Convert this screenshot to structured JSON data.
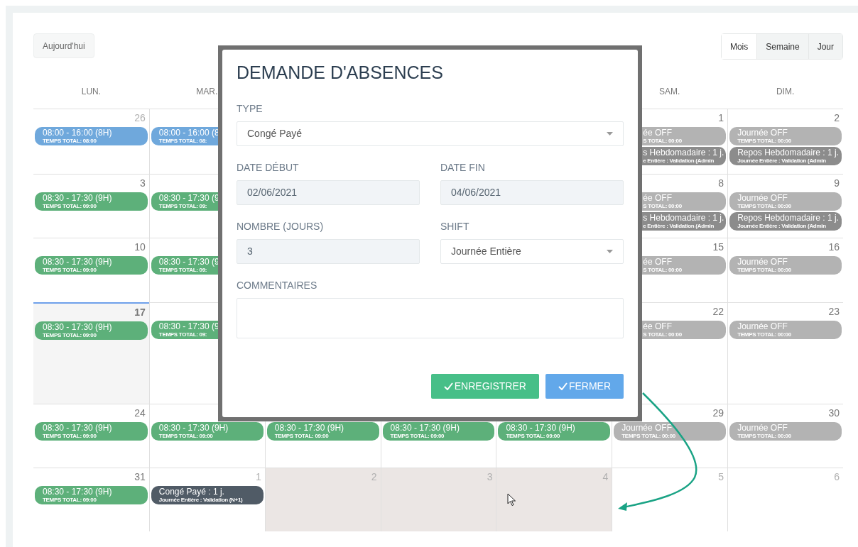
{
  "toolbar": {
    "today_button": "Aujourd'hui",
    "views": [
      {
        "label": "Mois",
        "selected": true
      },
      {
        "label": "Semaine",
        "selected": false
      },
      {
        "label": "Jour",
        "selected": false
      }
    ]
  },
  "weekdays": [
    "LUN.",
    "MAR.",
    "SAM.",
    "DIM."
  ],
  "weeks": [
    {
      "cells": [
        {
          "day": "26",
          "other_month": true,
          "today": false,
          "selected": false,
          "events": [
            {
              "title": "08:00 - 16:00 (8H)",
              "subtitle": "TEMPS TOTAL: 08:00",
              "color": "#6fa8dc"
            }
          ]
        },
        {
          "today": false,
          "selected": false,
          "events": [
            {
              "title": "08:00 - 16:00 (8",
              "subtitle": "TEMPS TOTAL: 08:",
              "color": "#6fa8dc"
            }
          ]
        },
        null,
        null,
        null,
        {
          "day": "1",
          "other_month": false,
          "today": false,
          "selected": false,
          "events": [
            {
              "title": "ée OFF",
              "subtitle": "S TOTAL: 00:00",
              "color": "#b3b3b3"
            },
            {
              "title": "s Hebdomadaire : 1 j.",
              "subtitle": "e Entière : Validation (Admin",
              "color": "#8c8c8c"
            }
          ]
        },
        {
          "day": "2",
          "other_month": false,
          "today": false,
          "selected": false,
          "events": [
            {
              "title": "Journée OFF",
              "subtitle": "TEMPS TOTAL: 00:00",
              "color": "#b3b3b3"
            },
            {
              "title": "Repos Hebdomadaire : 1 j.",
              "subtitle": "Journée Entière : Validation (Admin",
              "color": "#8c8c8c"
            }
          ]
        }
      ]
    },
    {
      "cells": [
        {
          "day": "3",
          "other_month": false,
          "today": false,
          "selected": false,
          "events": [
            {
              "title": "08:30 - 17:30 (9H)",
              "subtitle": "TEMPS TOTAL: 09:00",
              "color": "#5db07a"
            }
          ]
        },
        {
          "today": false,
          "selected": false,
          "events": [
            {
              "title": "08:30 - 17:30 (9",
              "subtitle": "TEMPS TOTAL: 09:",
              "color": "#5db07a"
            }
          ]
        },
        null,
        null,
        null,
        {
          "day": "8",
          "other_month": false,
          "today": false,
          "selected": false,
          "events": [
            {
              "title": "ée OFF",
              "subtitle": "S TOTAL: 00:00",
              "color": "#b3b3b3"
            },
            {
              "title": "s Hebdomadaire : 1 j.",
              "subtitle": "e Entière : Validation (Admin",
              "color": "#8c8c8c"
            }
          ]
        },
        {
          "day": "9",
          "other_month": false,
          "today": false,
          "selected": false,
          "events": [
            {
              "title": "Journée OFF",
              "subtitle": "TEMPS TOTAL: 00:00",
              "color": "#b3b3b3"
            },
            {
              "title": "Repos Hebdomadaire : 1 j.",
              "subtitle": "Journée Entière : Validation (Admin",
              "color": "#8c8c8c"
            }
          ]
        }
      ]
    },
    {
      "cells": [
        {
          "day": "10",
          "other_month": false,
          "today": false,
          "selected": false,
          "events": [
            {
              "title": "08:30 - 17:30 (9H)",
              "subtitle": "TEMPS TOTAL: 09:00",
              "color": "#5db07a"
            }
          ]
        },
        {
          "today": false,
          "selected": false,
          "events": [
            {
              "title": "08:30 - 17:30 (9",
              "subtitle": "TEMPS TOTAL: 09:",
              "color": "#5db07a"
            }
          ]
        },
        null,
        null,
        null,
        {
          "day": "15",
          "other_month": false,
          "today": false,
          "selected": false,
          "events": [
            {
              "title": "ée OFF",
              "subtitle": "S TOTAL: 00:00",
              "color": "#b3b3b3"
            }
          ]
        },
        {
          "day": "16",
          "other_month": false,
          "today": false,
          "selected": false,
          "events": [
            {
              "title": "Journée OFF",
              "subtitle": "TEMPS TOTAL: 00:00",
              "color": "#b3b3b3"
            }
          ]
        }
      ]
    },
    {
      "cells": [
        {
          "day": "17",
          "other_month": false,
          "today": true,
          "selected": false,
          "events": [
            {
              "title": "08:30 - 17:30 (9H)",
              "subtitle": "TEMPS TOTAL: 09:00",
              "color": "#5db07a"
            }
          ]
        },
        {
          "today": false,
          "selected": false,
          "events": [
            {
              "title": "08:30 - 17:30 (9",
              "subtitle": "TEMPS TOTAL: 09:",
              "color": "#5db07a"
            }
          ]
        },
        null,
        null,
        null,
        {
          "day": "22",
          "other_month": false,
          "today": false,
          "selected": false,
          "events": [
            {
              "title": "ée OFF",
              "subtitle": "S TOTAL: 00:00",
              "color": "#b3b3b3"
            }
          ]
        },
        {
          "day": "23",
          "other_month": false,
          "today": false,
          "selected": false,
          "events": [
            {
              "title": "Journée OFF",
              "subtitle": "TEMPS TOTAL: 00:00",
              "color": "#b3b3b3"
            }
          ]
        }
      ]
    },
    {
      "cells": [
        {
          "day": "24",
          "other_month": false,
          "today": false,
          "selected": false,
          "events": [
            {
              "title": "08:30 - 17:30 (9H)",
              "subtitle": "TEMPS TOTAL: 09:00",
              "color": "#5db07a"
            }
          ]
        },
        {
          "today": false,
          "selected": false,
          "events": [
            {
              "title": "08:30 - 17:30 (9H)",
              "subtitle": "TEMPS TOTAL: 09:00",
              "color": "#5db07a"
            }
          ]
        },
        {
          "today": false,
          "selected": false,
          "events": [
            {
              "title": "08:30 - 17:30 (9H)",
              "subtitle": "TEMPS TOTAL: 09:00",
              "color": "#5db07a"
            }
          ]
        },
        {
          "today": false,
          "selected": false,
          "events": [
            {
              "title": "08:30 - 17:30 (9H)",
              "subtitle": "TEMPS TOTAL: 09:00",
              "color": "#5db07a"
            }
          ]
        },
        {
          "today": false,
          "selected": false,
          "events": [
            {
              "title": "08:30 - 17:30 (9H)",
              "subtitle": "TEMPS TOTAL: 09:00",
              "color": "#5db07a"
            }
          ]
        },
        {
          "day": "29",
          "other_month": false,
          "today": false,
          "selected": false,
          "events": [
            {
              "title": "Journée OFF",
              "subtitle": "TEMPS TOTAL: 00:00",
              "color": "#b3b3b3"
            }
          ]
        },
        {
          "day": "30",
          "other_month": false,
          "today": false,
          "selected": false,
          "events": [
            {
              "title": "Journée OFF",
              "subtitle": "TEMPS TOTAL: 00:00",
              "color": "#b3b3b3"
            }
          ]
        }
      ]
    },
    {
      "cells": [
        {
          "day": "31",
          "other_month": false,
          "today": false,
          "selected": false,
          "events": [
            {
              "title": "08:30 - 17:30 (9H)",
              "subtitle": "TEMPS TOTAL: 09:00",
              "color": "#5db07a"
            }
          ]
        },
        {
          "day": "1",
          "other_month": true,
          "today": false,
          "selected": false,
          "events": [
            {
              "title": "Congé Payé : 1 j.",
              "subtitle": "Journée Entière : Validation (N+1)",
              "color": "#505b66"
            }
          ]
        },
        {
          "day": "2",
          "other_month": true,
          "today": false,
          "selected": true
        },
        {
          "day": "3",
          "other_month": true,
          "today": false,
          "selected": true
        },
        {
          "day": "4",
          "other_month": true,
          "today": false,
          "selected": true
        },
        {
          "day": "5",
          "other_month": true,
          "today": false,
          "selected": false
        },
        {
          "day": "6",
          "other_month": true,
          "today": false,
          "selected": false
        }
      ]
    }
  ],
  "modal": {
    "title": "DEMANDE D'ABSENCES",
    "fields": [
      {
        "label": "TYPE",
        "kind": "select",
        "value": "Congé Payé",
        "disabled": false,
        "wide": true
      },
      {
        "label": "DATE DÉBUT",
        "kind": "input",
        "value": "02/06/2021",
        "disabled": true,
        "wide": false
      },
      {
        "label": "DATE FIN",
        "kind": "input",
        "value": "04/06/2021",
        "disabled": true,
        "wide": false
      },
      {
        "label": "NOMBRE (JOURS)",
        "kind": "input",
        "value": "3",
        "disabled": true,
        "wide": false
      },
      {
        "label": "SHIFT",
        "kind": "select",
        "value": "Journée Entière",
        "disabled": false,
        "wide": false
      },
      {
        "label": "COMMENTAIRES",
        "kind": "textarea",
        "disabled": false,
        "wide": true
      }
    ],
    "buttons": [
      {
        "label": "ENREGISTRER",
        "kind": "save"
      },
      {
        "label": "FERMER",
        "kind": "close"
      }
    ]
  }
}
